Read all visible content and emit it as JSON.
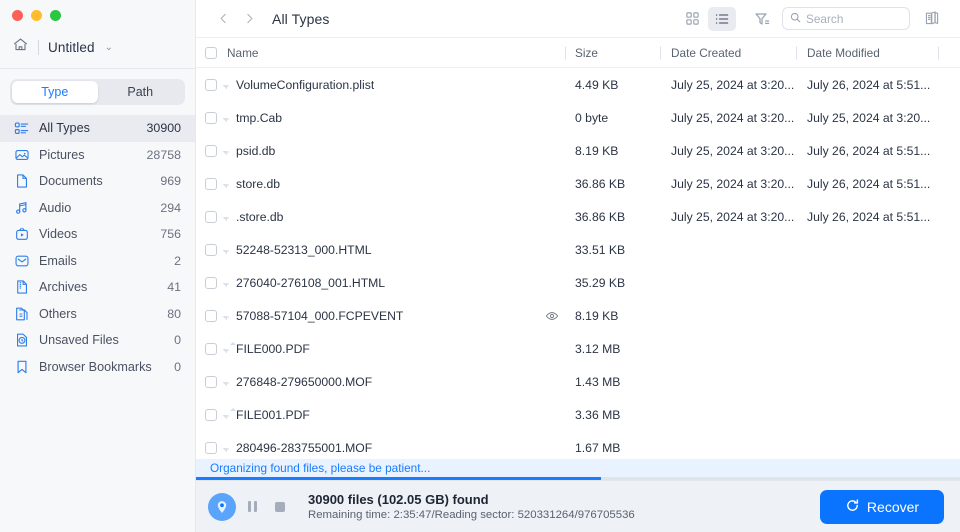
{
  "window": {
    "traffic_lights": [
      "close",
      "minimize",
      "zoom"
    ],
    "home_icon": "home-icon",
    "title": "Untitled",
    "title_chevron": "chevron-down-icon"
  },
  "sidebar": {
    "segmented": {
      "options": [
        "Type",
        "Path"
      ],
      "selected": "Type"
    },
    "items": [
      {
        "icon": "all-types-icon",
        "label": "All Types",
        "count": "30900",
        "active": true,
        "info": false
      },
      {
        "icon": "pictures-icon",
        "label": "Pictures",
        "count": "28758",
        "active": false,
        "info": false
      },
      {
        "icon": "documents-icon",
        "label": "Documents",
        "count": "969",
        "active": false,
        "info": false
      },
      {
        "icon": "audio-icon",
        "label": "Audio",
        "count": "294",
        "active": false,
        "info": false
      },
      {
        "icon": "videos-icon",
        "label": "Videos",
        "count": "756",
        "active": false,
        "info": false
      },
      {
        "icon": "emails-icon",
        "label": "Emails",
        "count": "2",
        "active": false,
        "info": false
      },
      {
        "icon": "archives-icon",
        "label": "Archives",
        "count": "41",
        "active": false,
        "info": false
      },
      {
        "icon": "others-icon",
        "label": "Others",
        "count": "80",
        "active": false,
        "info": false
      },
      {
        "icon": "unsaved-files-icon",
        "label": "Unsaved Files",
        "count": "0",
        "active": false,
        "info": true
      },
      {
        "icon": "browser-bookmarks-icon",
        "label": "Browser Bookmarks",
        "count": "0",
        "active": false,
        "info": false
      }
    ]
  },
  "toolbar": {
    "back_icon": "chevron-left-icon",
    "forward_icon": "chevron-right-icon",
    "breadcrumb": "All Types",
    "grid_view_icon": "grid-view-icon",
    "list_view_icon": "list-view-icon",
    "active_view": "list",
    "filter_icon": "filter-icon",
    "search": {
      "icon": "search-icon",
      "placeholder": "Search",
      "value": ""
    },
    "guide_icon": "guide-book-icon"
  },
  "table": {
    "columns": [
      "Name",
      "Size",
      "Date Created",
      "Date Modified"
    ],
    "select_all_checkbox": false,
    "rows": [
      {
        "icon": "file-generic-icon",
        "name": "VolumeConfiguration.plist",
        "size": "4.49 KB",
        "date_created": "July 25, 2024 at 3:20...",
        "date_modified": "July 26, 2024 at 5:51...",
        "preview": false
      },
      {
        "icon": "file-generic-icon",
        "name": "tmp.Cab",
        "size": "0 byte",
        "date_created": "July 25, 2024 at 3:20...",
        "date_modified": "July 25, 2024 at 3:20...",
        "preview": false
      },
      {
        "icon": "file-generic-icon",
        "name": "psid.db",
        "size": "8.19 KB",
        "date_created": "July 25, 2024 at 3:20...",
        "date_modified": "July 26, 2024 at 5:51...",
        "preview": false
      },
      {
        "icon": "file-generic-icon",
        "name": "store.db",
        "size": "36.86 KB",
        "date_created": "July 25, 2024 at 3:20...",
        "date_modified": "July 26, 2024 at 5:51...",
        "preview": false
      },
      {
        "icon": "file-generic-icon",
        "name": ".store.db",
        "size": "36.86 KB",
        "date_created": "July 25, 2024 at 3:20...",
        "date_modified": "July 26, 2024 at 5:51...",
        "preview": false
      },
      {
        "icon": "file-html-icon",
        "name": "52248-52313_000.HTML",
        "size": "33.51 KB",
        "date_created": "",
        "date_modified": "",
        "preview": false
      },
      {
        "icon": "file-html-icon",
        "name": "276040-276108_001.HTML",
        "size": "35.29 KB",
        "date_created": "",
        "date_modified": "",
        "preview": false
      },
      {
        "icon": "file-generic-icon",
        "name": "57088-57104_000.FCPEVENT",
        "size": "8.19 KB",
        "date_created": "",
        "date_modified": "",
        "preview": true
      },
      {
        "icon": "file-pdf-icon",
        "name": "FILE000.PDF",
        "size": "3.12 MB",
        "date_created": "",
        "date_modified": "",
        "preview": false
      },
      {
        "icon": "file-generic-icon",
        "name": "276848-279650000.MOF",
        "size": "1.43 MB",
        "date_created": "",
        "date_modified": "",
        "preview": false
      },
      {
        "icon": "file-pdf-icon",
        "name": "FILE001.PDF",
        "size": "3.36 MB",
        "date_created": "",
        "date_modified": "",
        "preview": false
      },
      {
        "icon": "file-generic-icon",
        "name": "280496-283755001.MOF",
        "size": "1.67 MB",
        "date_created": "",
        "date_modified": "",
        "preview": false
      }
    ],
    "preview_icon": "eye-icon"
  },
  "status": {
    "organizing_message": "Organizing found files, please be patient...",
    "progress_percent": 53
  },
  "footer": {
    "scan_icon": "scan-location-icon",
    "pause_icon": "pause-icon",
    "stop_icon": "stop-icon",
    "primary_text": "30900 files (102.05 GB) found",
    "secondary_text": "Remaining time: 2:35:47/Reading sector: 520331264/976705536",
    "recover_button": {
      "label": "Recover",
      "icon": "refresh-icon"
    }
  },
  "colors": {
    "accent": "#0a74ff",
    "sidebar_bg": "#f7f8fa",
    "footer_bg": "#eef1f6",
    "banner_bg": "#e9f2ff"
  }
}
